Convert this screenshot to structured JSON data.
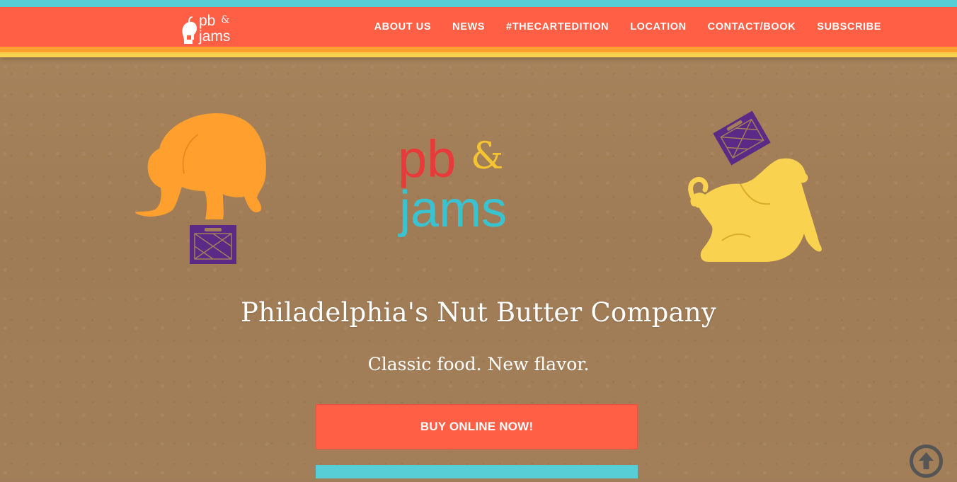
{
  "brand": {
    "logo_text_top": "pb",
    "logo_amp": "&",
    "logo_text_bottom": "jams"
  },
  "nav": {
    "items": [
      {
        "label": "ABOUT US"
      },
      {
        "label": "NEWS"
      },
      {
        "label": "#THECARTEDITION"
      },
      {
        "label": "LOCATION"
      },
      {
        "label": "CONTACT/BOOK"
      },
      {
        "label": "SUBSCRIBE"
      }
    ]
  },
  "hero": {
    "headline": "Philadelphia's Nut Butter Company",
    "tagline": "Classic food. New flavor.",
    "buy_button": "BUY ONLINE NOW!"
  },
  "icons": {
    "scroll_top": "arrow-up-circle-icon",
    "elephant_left": "orange-elephant-on-crate",
    "elephant_right": "yellow-elephant-with-crate"
  },
  "colors": {
    "nav_red": "#ff5f45",
    "teal": "#57cdd6",
    "orange": "#ffa02e",
    "yellow": "#f9d24f",
    "purple": "#5b2a86",
    "kraft": "#a17e59"
  }
}
